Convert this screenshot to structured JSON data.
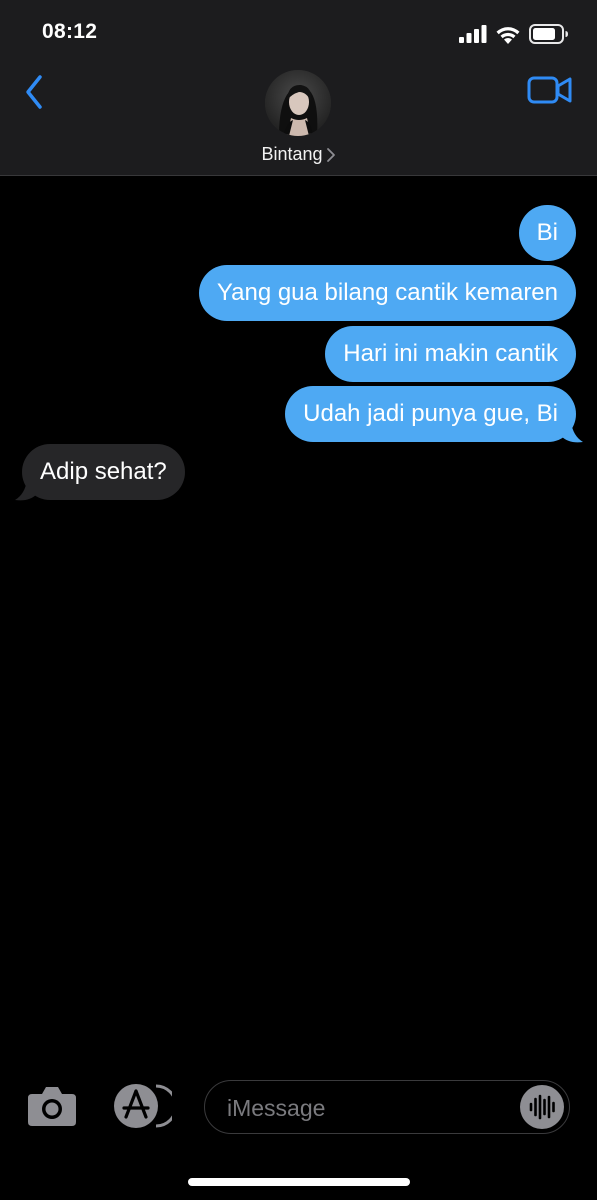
{
  "status_bar": {
    "time": "08:12",
    "icons": [
      "cellular-signal-icon",
      "wifi-icon",
      "battery-icon"
    ]
  },
  "header": {
    "contact_name": "Bintang",
    "back_icon": "chevron-left-icon",
    "video_icon": "video-camera-icon",
    "accent_color": "#2f8bf5"
  },
  "messages": [
    {
      "direction": "sent",
      "text": "Bi"
    },
    {
      "direction": "sent",
      "text": "Yang gua bilang cantik kemaren"
    },
    {
      "direction": "sent",
      "text": "Hari ini makin cantik"
    },
    {
      "direction": "sent",
      "text": "Udah jadi punya gue, Bi"
    },
    {
      "direction": "received",
      "text": "Adip sehat?"
    }
  ],
  "colors": {
    "sent_bubble": "#4ea9f3",
    "received_bubble": "#262628",
    "background": "#000000",
    "header_background": "#1c1c1e"
  },
  "composer": {
    "placeholder": "iMessage",
    "value": "",
    "camera_icon": "camera-icon",
    "apps_icon": "app-store-icon",
    "audio_icon": "audio-waveform-icon"
  }
}
